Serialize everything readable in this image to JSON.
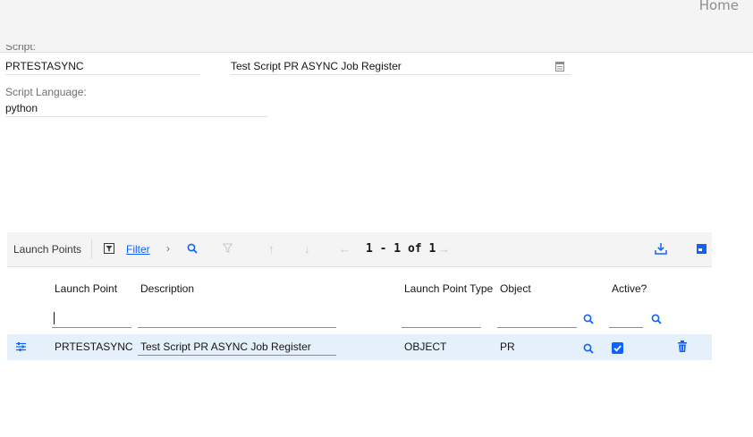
{
  "header": {
    "home_label": "Home"
  },
  "script_section": {
    "script_label": "Script:",
    "script_value": "PRTESTASYNC",
    "description_value": "Test Script PR ASYNC Job Register",
    "language_label": "Script Language:",
    "language_value": "python"
  },
  "launch_points": {
    "title": "Launch Points",
    "filter_label": "Filter",
    "pager": "1 - 1 of 1",
    "columns": {
      "launch_point": "Launch Point",
      "description": "Description",
      "type": "Launch Point Type",
      "object": "Object",
      "active": "Active?"
    },
    "rows": [
      {
        "launch_point": "PRTESTASYNC",
        "description": "Test Script PR ASYNC Job Register",
        "type": "OBJECT",
        "object": "PR",
        "active": true
      }
    ]
  },
  "colors": {
    "accent": "#0f62fe",
    "selected_row": "#e5f0fb",
    "toolbar_bg": "#f4f4f4"
  },
  "icons": [
    "details-icon",
    "filter-icon",
    "search-icon",
    "clear-filter-icon",
    "arrow-up-icon",
    "arrow-down-icon",
    "previous-page-icon",
    "next-page-icon",
    "download-icon",
    "table-settings-icon",
    "row-details-icon",
    "checkbox-checked-icon",
    "delete-icon"
  ]
}
